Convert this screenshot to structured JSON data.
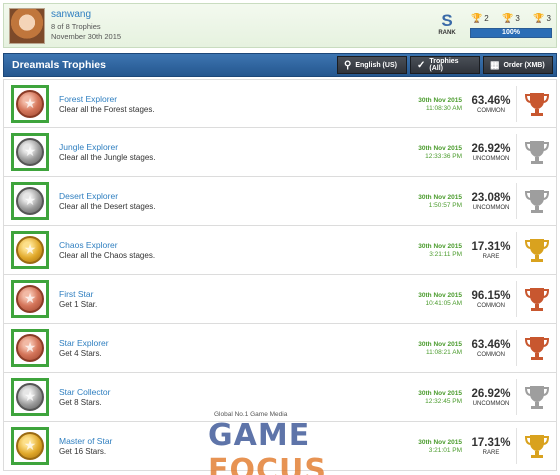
{
  "profile": {
    "name": "sanwang",
    "trophy_count": "8 of 8 Trophies",
    "date": "November 30th 2015",
    "rank_letter": "S",
    "rank_label": "RANK",
    "gold": "2",
    "silver": "3",
    "bronze": "3",
    "progress": "100%",
    "progress_value": 1.0
  },
  "header": {
    "title": "Dreamals Trophies",
    "language_button": "English (US)",
    "filter_button": "Trophies (All)",
    "order_button": "Order (XMB)"
  },
  "trophies": [
    {
      "name": "Forest Explorer",
      "desc": "Clear all the Forest stages.",
      "date": "30th Nov 2015",
      "time": "11:08:30 AM",
      "pct": "63.46%",
      "rarity": "COMMON",
      "tier": "bronze",
      "tier_color": "#c8572f"
    },
    {
      "name": "Jungle Explorer",
      "desc": "Clear all the Jungle stages.",
      "date": "30th Nov 2015",
      "time": "12:33:36 PM",
      "pct": "26.92%",
      "rarity": "UNCOMMON",
      "tier": "silver",
      "tier_color": "#9e9e9e"
    },
    {
      "name": "Desert Explorer",
      "desc": "Clear all the Desert stages.",
      "date": "30th Nov 2015",
      "time": "1:50:57 PM",
      "pct": "23.08%",
      "rarity": "UNCOMMON",
      "tier": "silver",
      "tier_color": "#9e9e9e"
    },
    {
      "name": "Chaos Explorer",
      "desc": "Clear all the Chaos stages.",
      "date": "30th Nov 2015",
      "time": "3:21:11 PM",
      "pct": "17.31%",
      "rarity": "RARE",
      "tier": "gold",
      "tier_color": "#d9a21e"
    },
    {
      "name": "First Star",
      "desc": "Get 1 Star.",
      "date": "30th Nov 2015",
      "time": "10:41:05 AM",
      "pct": "96.15%",
      "rarity": "COMMON",
      "tier": "bronze",
      "tier_color": "#c8572f"
    },
    {
      "name": "Star Explorer",
      "desc": "Get 4 Stars.",
      "date": "30th Nov 2015",
      "time": "11:08:21 AM",
      "pct": "63.46%",
      "rarity": "COMMON",
      "tier": "bronze",
      "tier_color": "#c8572f"
    },
    {
      "name": "Star Collector",
      "desc": "Get 8 Stars.",
      "date": "30th Nov 2015",
      "time": "12:32:45 PM",
      "pct": "26.92%",
      "rarity": "UNCOMMON",
      "tier": "silver",
      "tier_color": "#9e9e9e"
    },
    {
      "name": "Master of Star",
      "desc": "Get 16 Stars.",
      "date": "30th Nov 2015",
      "time": "3:21:01 PM",
      "pct": "17.31%",
      "rarity": "RARE",
      "tier": "gold",
      "tier_color": "#d9a21e"
    }
  ],
  "watermark": {
    "tagline": "Global No.1 Game Media",
    "brand_a": "GAME",
    "brand_b": "FOCUS"
  }
}
